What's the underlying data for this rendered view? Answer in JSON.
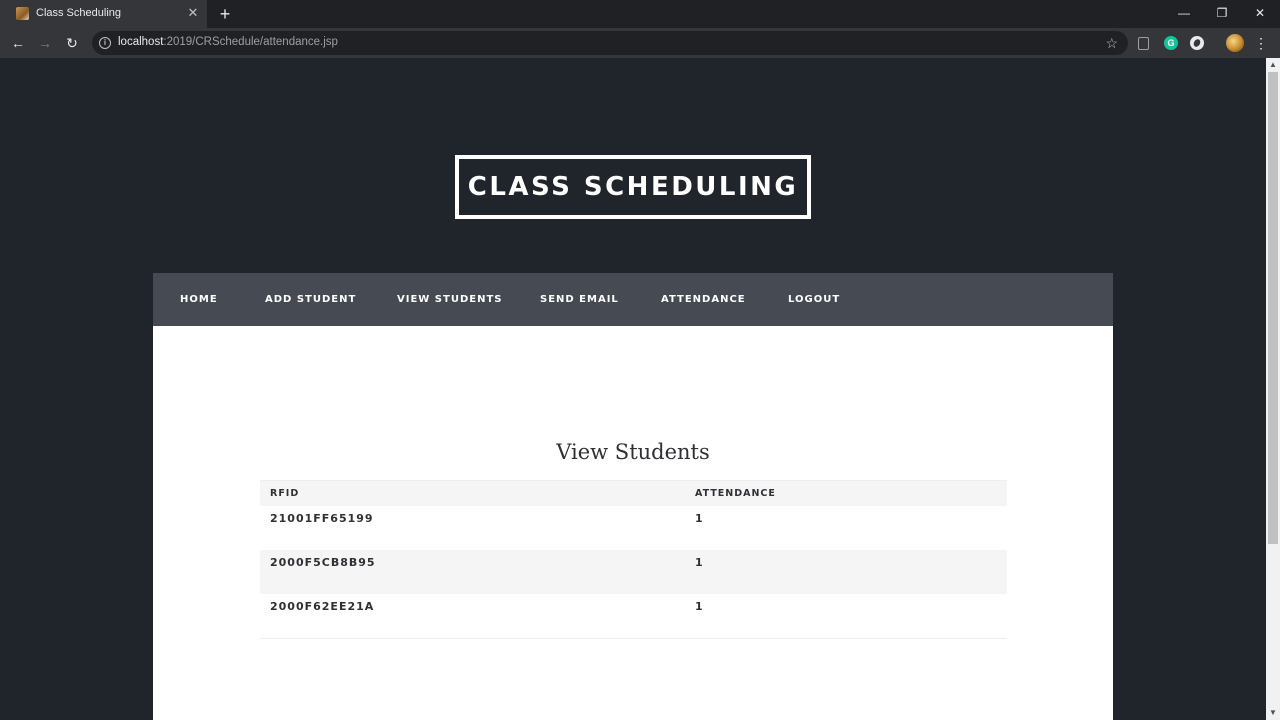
{
  "browser": {
    "tab_title": "Class Scheduling",
    "url_host": "localhost",
    "url_rest": ":2019/CRSchedule/attendance.jsp",
    "extension_g_label": "G"
  },
  "site": {
    "title": "CLASS SCHEDULING"
  },
  "nav": {
    "items": [
      {
        "label": "HOME"
      },
      {
        "label": "ADD STUDENT"
      },
      {
        "label": "VIEW STUDENTS"
      },
      {
        "label": "SEND EMAIL"
      },
      {
        "label": "ATTENDANCE"
      },
      {
        "label": "LOGOUT"
      }
    ]
  },
  "main": {
    "heading": "View Students",
    "table": {
      "columns": [
        "RFID",
        "ATTENDANCE"
      ],
      "rows": [
        [
          "21001FF65199",
          "1"
        ],
        [
          "2000F5CB8B95",
          "1"
        ],
        [
          "2000F62EE21A",
          "1"
        ]
      ]
    }
  },
  "colors": {
    "page_background": "#20242b",
    "navbar_background": "#464b53",
    "content_background": "#ffffff",
    "text_dark": "#2e3035"
  }
}
